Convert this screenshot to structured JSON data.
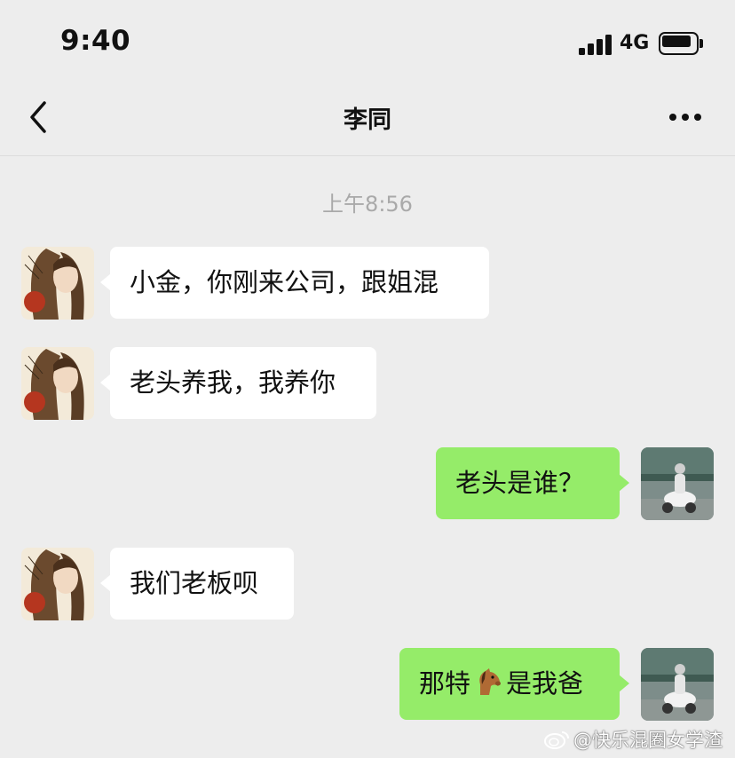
{
  "status_bar": {
    "time": "9:40",
    "network": "4G",
    "signal_icon": "signal-bars-icon",
    "battery_icon": "battery-icon"
  },
  "nav": {
    "title": "李同",
    "back_icon": "chevron-left-icon",
    "more_icon": "more-dots-icon"
  },
  "chat": {
    "timestamp": "上午8:56",
    "messages": [
      {
        "direction": "incoming",
        "text": "小金，你刚来公司，跟姐混"
      },
      {
        "direction": "incoming",
        "text": "老头养我，我养你"
      },
      {
        "direction": "outgoing",
        "text": "老头是谁？"
      },
      {
        "direction": "incoming",
        "text": "我们老板呗"
      },
      {
        "direction": "outgoing",
        "text_before": "那特",
        "emoji": "horse-emoji",
        "text_after": "是我爸"
      }
    ]
  },
  "watermark": {
    "text": "@快乐混圈女学渣",
    "icon": "weibo-icon"
  },
  "colors": {
    "background": "#ededed",
    "incoming_bubble": "#ffffff",
    "outgoing_bubble": "#95ec69",
    "timestamp_text": "#a9a9a9"
  }
}
